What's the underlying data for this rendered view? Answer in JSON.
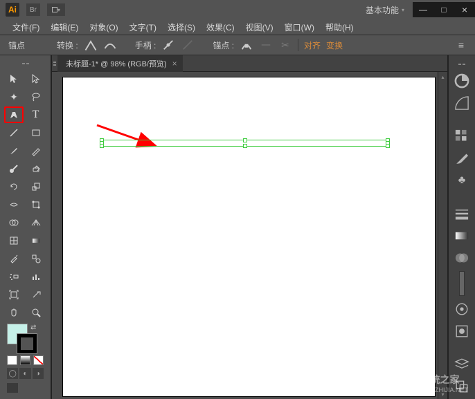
{
  "app": {
    "logo_text": "Ai"
  },
  "workspace_selector": "基本功能",
  "window_controls": {
    "min": "—",
    "max": "□",
    "close": "×"
  },
  "menubar": [
    "文件(F)",
    "编辑(E)",
    "对象(O)",
    "文字(T)",
    "选择(S)",
    "效果(C)",
    "视图(V)",
    "窗口(W)",
    "帮助(H)"
  ],
  "options": {
    "mode_label": "锚点",
    "convert_label": "转换 :",
    "handle_label": "手柄 :",
    "anchor_label": "锚点 :",
    "align_link": "对齐",
    "transform_link": "变换",
    "menu_icon": "≡"
  },
  "document": {
    "tab_title": "未标题-1* @ 98% (RGB/预览)",
    "close_x": "×"
  },
  "tools": {
    "selection": "selection-tool",
    "direct_select": "direct-selection-tool",
    "magic_wand": "magic-wand-tool",
    "lasso": "lasso-tool",
    "pen": "pen-tool",
    "type": "type-tool",
    "line": "line-tool",
    "rect": "rectangle-tool",
    "brush": "brush-tool",
    "pencil": "pencil-tool",
    "blob": "blob-brush-tool",
    "eraser": "eraser-tool",
    "rotate": "rotate-tool",
    "scale": "scale-tool",
    "width": "width-tool",
    "free": "free-transform-tool",
    "shapebuilder": "shape-builder-tool",
    "perspective": "perspective-grid-tool",
    "mesh": "mesh-tool",
    "gradient": "gradient-tool",
    "eyedropper": "eyedropper-tool",
    "blend": "blend-tool",
    "spray": "symbol-sprayer-tool",
    "graph": "column-graph-tool",
    "artboard": "artboard-tool",
    "slice": "slice-tool",
    "hand": "hand-tool",
    "zoom": "zoom-tool"
  },
  "colors": {
    "fill": "#c5f0e8",
    "stroke": "#000000"
  },
  "right_panels": [
    "color",
    "color-guide",
    "swatches",
    "brushes",
    "symbols",
    "stroke",
    "gradient",
    "transparency",
    "appearance",
    "graphic-styles",
    "layers"
  ],
  "watermark": {
    "title": "系统之家",
    "url": "ONGZHIJIA.NET"
  }
}
